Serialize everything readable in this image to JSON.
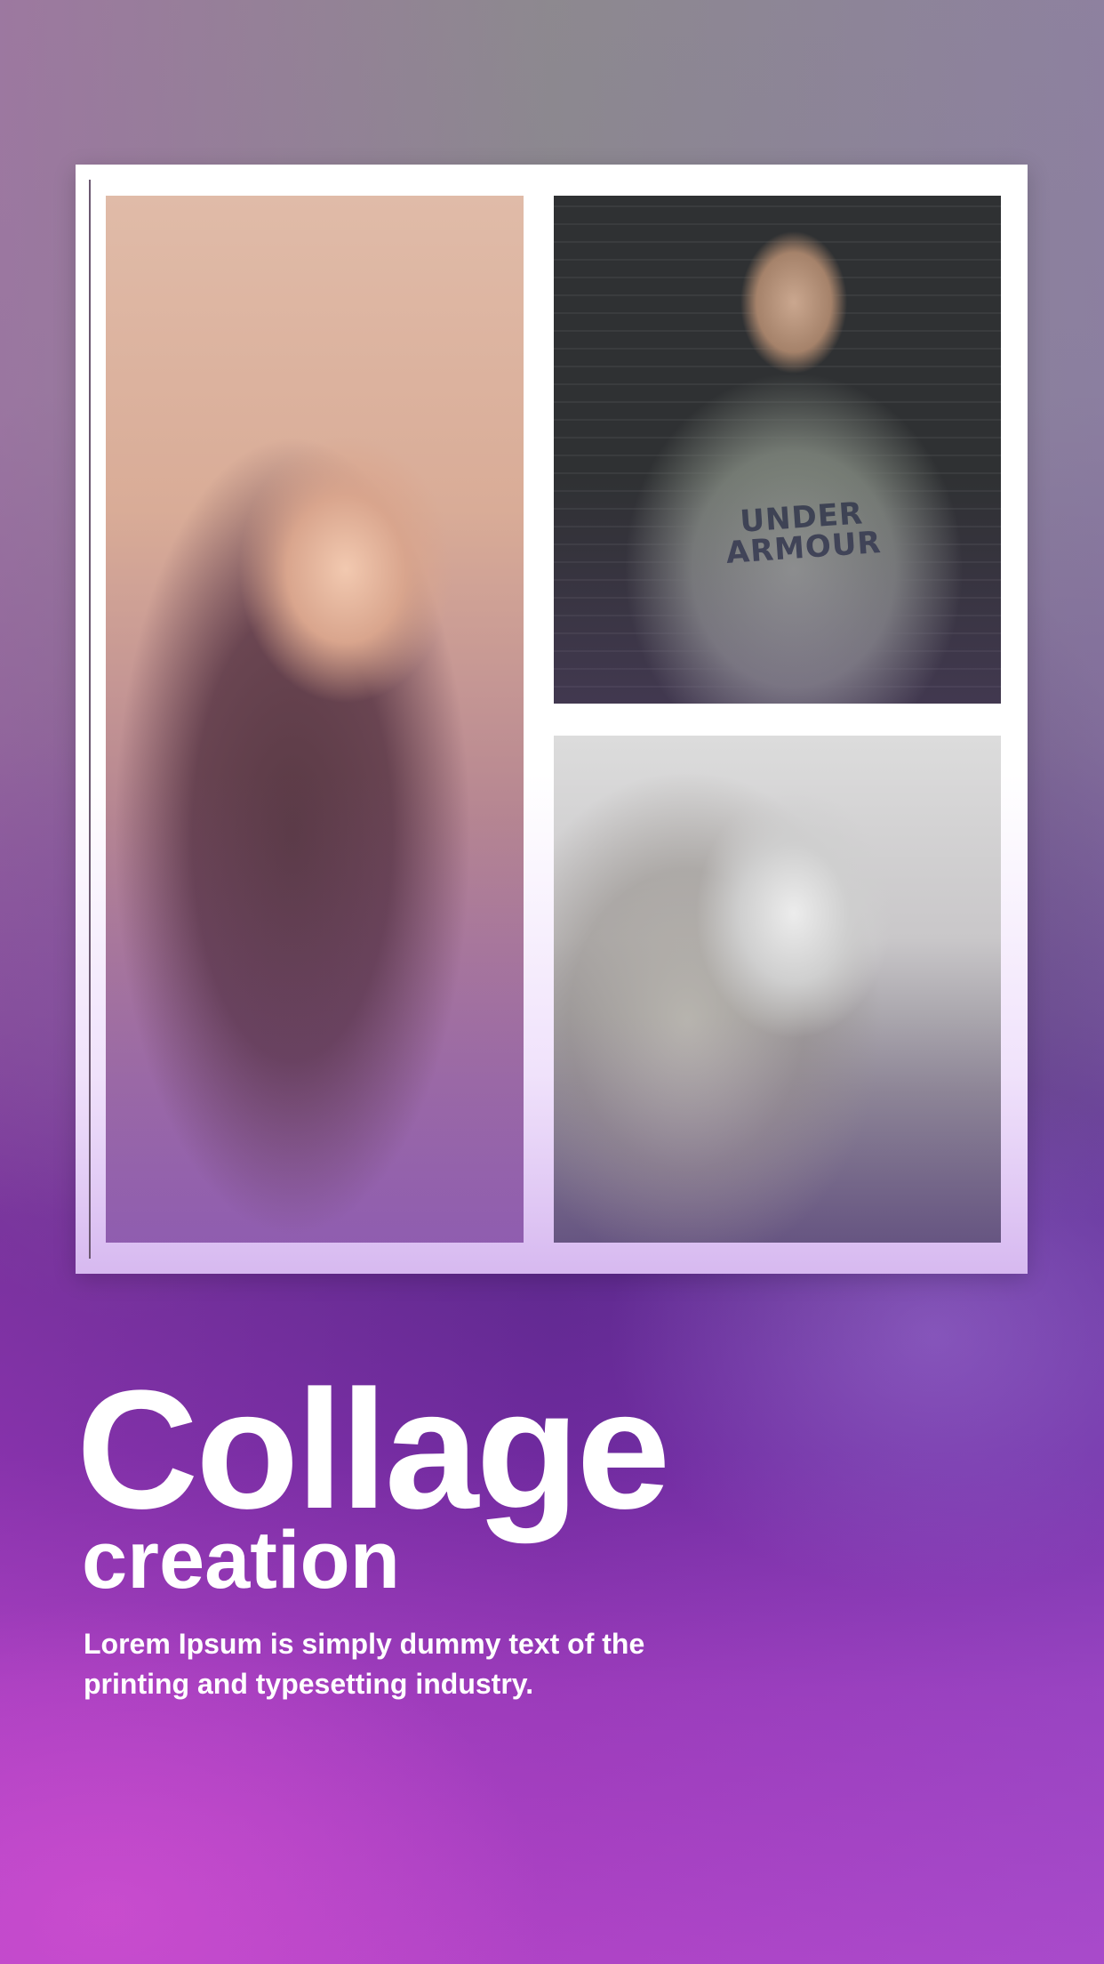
{
  "background": {
    "top_color": "#8e8e8e",
    "bottom_color": "#b245c8"
  },
  "collage": {
    "frame_color": "#ffffff",
    "photos": [
      {
        "name": "portrait-long-hair"
      },
      {
        "name": "woman-grey-sweatshirt",
        "shirt_text": "UNDER ARMOUR"
      },
      {
        "name": "woman-hands-on-chin"
      }
    ]
  },
  "headline": {
    "title": "Collage",
    "subtitle": "creation",
    "description": "Lorem Ipsum is simply dummy text of the printing and typesetting industry."
  }
}
